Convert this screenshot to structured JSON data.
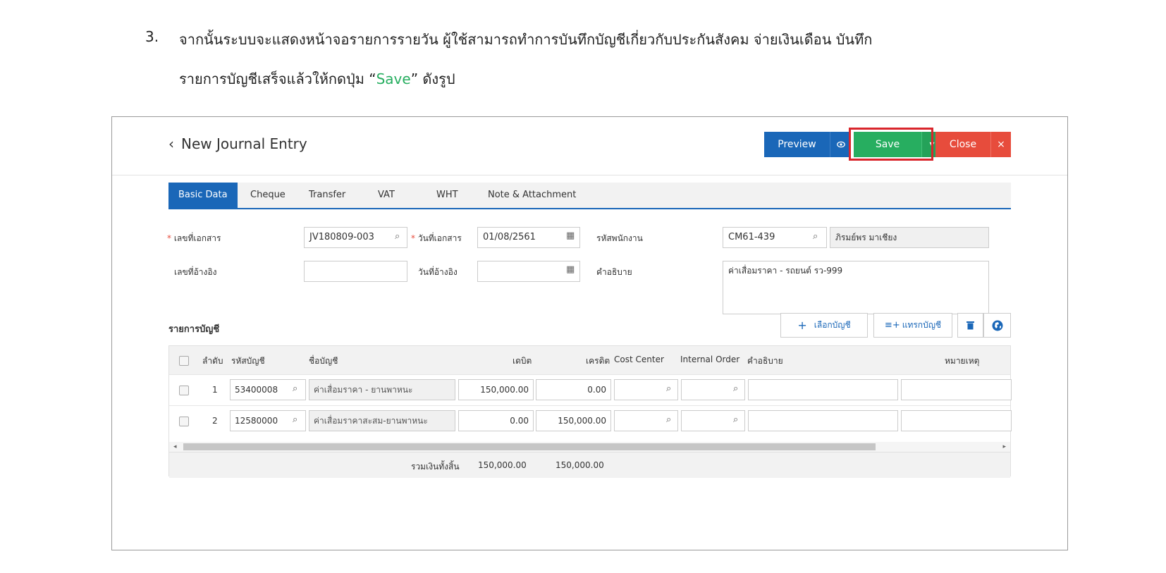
{
  "instructions": {
    "number": "3.",
    "line1": "จากนั้นระบบจะแสดงหน้าจอรายการรายวัน ผู้ใช้สามารถทำการบันทึกบัญชีเกี่ยวกับประกันสังคม จ่ายเงินเดือน บันทึก",
    "line2_before": "รายการบัญชีเสร็จแล้วให้กดปุ่ม “",
    "line2_highlight": "Save",
    "line2_after": "” ดังรูป"
  },
  "header": {
    "back_icon": "‹",
    "title": "New Journal Entry",
    "preview_label": "Preview",
    "eye_icon": "👁",
    "save_label": "Save",
    "save_dropdown_icon": "▾",
    "close_label": "Close",
    "close_icon": "×"
  },
  "tabs": [
    {
      "label": "Basic Data"
    },
    {
      "label": "Cheque"
    },
    {
      "label": "Transfer"
    },
    {
      "label": "VAT"
    },
    {
      "label": "WHT"
    },
    {
      "label": "Note & Attachment"
    }
  ],
  "form": {
    "required_mark": "*",
    "doc_no_label": "เลขที่เอกสาร",
    "doc_no_value": "JV180809-003",
    "doc_date_label": "วันที่เอกสาร",
    "doc_date_value": "01/08/2561",
    "employee_code_label": "รหัสพนักงาน",
    "employee_code_value": "CM61-439",
    "employee_name_value": "ภิรมย์พร มาเชียง",
    "ref_no_label": "เลขที่อ้างอิง",
    "ref_no_value": "",
    "ref_date_label": "วันที่อ้างอิง",
    "ref_date_value": "",
    "description_label": "คำอธิบาย",
    "description_value": "ค่าเสื่อมราคา - รถยนต์ รว-999"
  },
  "accounts": {
    "section_title": "รายการบัญชี",
    "select_account_label": "เลือกบัญชี",
    "insert_account_label": "แทรกบัญชี",
    "columns": [
      "ลำดับ",
      "รหัสบัญชี",
      "ชื่อบัญชี",
      "เดบิต",
      "เครดิต",
      "Cost Center",
      "Internal Order",
      "คำอธิบาย",
      "หมายเหตุ"
    ],
    "rows": [
      {
        "no": "1",
        "code": "53400008",
        "name": "ค่าเสื่อมราคา - ยานพาหนะ",
        "debit": "150,000.00",
        "credit": "0.00"
      },
      {
        "no": "2",
        "code": "12580000",
        "name": "ค่าเสื่อมราคาสะสม-ยานพาหนะ",
        "debit": "0.00",
        "credit": "150,000.00"
      }
    ],
    "total_label": "รวมเงินทั้งสิ้น",
    "total_debit": "150,000.00",
    "total_credit": "150,000.00"
  },
  "colors": {
    "primary": "#1a67b8",
    "save": "#27ae60",
    "close": "#e74c3c",
    "highlight": "#d9262c"
  }
}
